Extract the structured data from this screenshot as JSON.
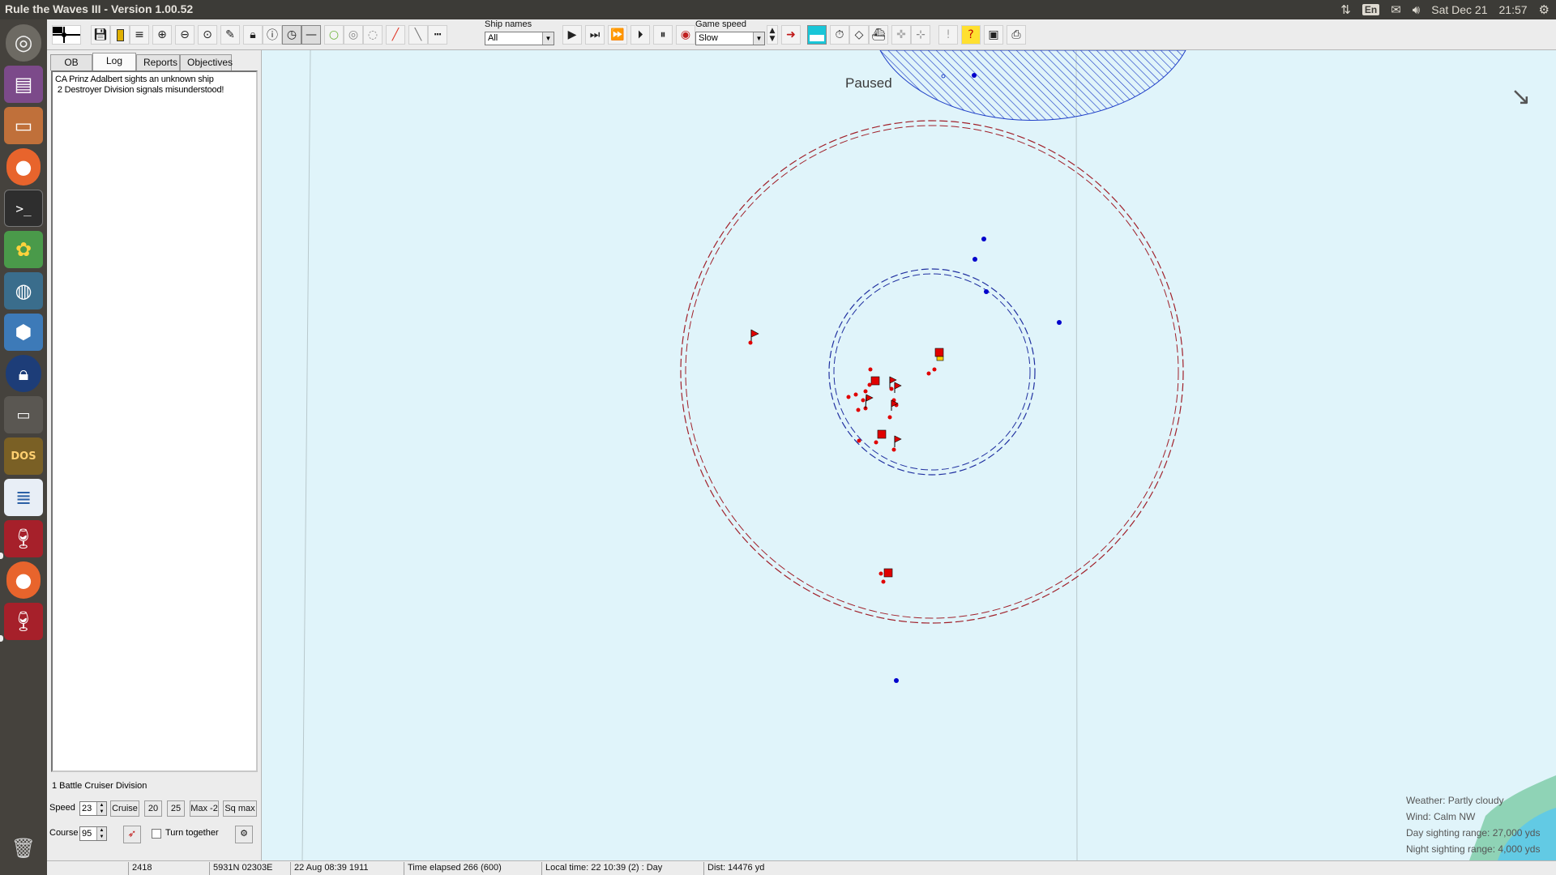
{
  "window": {
    "title": "Rule the Waves III - Version 1.00.52"
  },
  "panel": {
    "language": "En",
    "date": "Sat Dec 21",
    "time": "21:57"
  },
  "launcher": {
    "items": [
      "ubuntu-home",
      "files-manager",
      "archive",
      "firefox",
      "terminal",
      "color-app",
      "steam",
      "virtualbox",
      "lock-app",
      "window-app",
      "dosbox",
      "text-editor",
      "wine",
      "firefox",
      "wine",
      "trash"
    ]
  },
  "toolbar": {
    "ship_names_label": "Ship names",
    "ship_names_value": "All",
    "game_speed_label": "Game speed",
    "game_speed_value": "Slow"
  },
  "left_panel": {
    "tabs": [
      "OB",
      "Log",
      "Reports",
      "Objectives"
    ],
    "active_tab": "Log",
    "log_entries": [
      "CA Prinz Adalbert sights an unknown ship",
      " 2 Destroyer Division signals misunderstood!"
    ],
    "unit_name": "1 Battle Cruiser Division",
    "speed_label": "Speed",
    "speed_value": "23",
    "speed_buttons": [
      "Cruise",
      "20",
      "25",
      "Max -2",
      "Sq max"
    ],
    "course_label": "Course",
    "course_value": "95",
    "turn_together_label": "Turn together"
  },
  "map": {
    "paused_label": "Paused",
    "weather": [
      "Weather: Partly cloudy",
      "Wind: Calm  NW",
      "Day sighting range: 27,000 yds",
      "Night sighting range: 4,000 yds"
    ],
    "colors": {
      "sea": "#e0f4fa",
      "own_forces": "#e00000",
      "enemy_contacts": "#0000cc",
      "range_outer": "#a0202a",
      "range_inner": "#2030a0",
      "land": "#8fd3b6",
      "shallows": "#56c8f0"
    }
  },
  "status_bar": {
    "cells": [
      "",
      "2418",
      "5931N 02303E",
      "22 Aug 08:39 1911",
      "Time elapsed 266 (600)",
      "Local time: 22 10:39 (2) : Day",
      "Dist: 14476 yd"
    ]
  }
}
